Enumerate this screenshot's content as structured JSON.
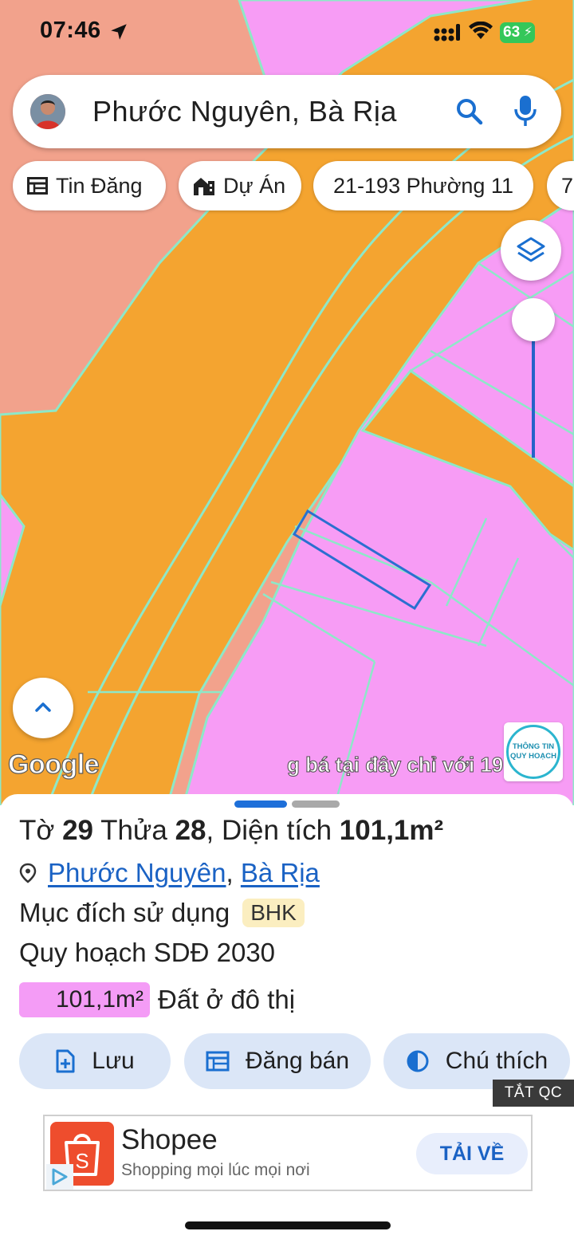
{
  "status_bar": {
    "time": "07:46",
    "battery": "63"
  },
  "search": {
    "text": "Phước Nguyên, Bà Rịa"
  },
  "chips": [
    {
      "label": "Tin Đăng",
      "icon": "listing-icon"
    },
    {
      "label": "Dự Án",
      "icon": "building-icon"
    },
    {
      "label": "21-193 Phường 11"
    },
    {
      "label": "7"
    }
  ],
  "map": {
    "attribution": "Google",
    "marquee": "g bá tại đây chỉ với 19",
    "info_badge": {
      "line1": "THÔNG TIN",
      "line2": "QUY HOẠCH"
    },
    "colors": {
      "road": "#f4a430",
      "residential": "#f79cf5",
      "other_land": "#f2a28c",
      "boundary": "#8de8c8",
      "selected": "#2a6fd0"
    },
    "opacity_slider_level": 1.0
  },
  "parcel": {
    "to_label": "Tờ ",
    "to_value": "29",
    "thua_label": " Thửa ",
    "thua_value": "28",
    "area_prefix": ", Diện tích ",
    "area_value": "101,1m²",
    "ward": "Phước Nguyên",
    "separator": ",",
    "city": "Bà Rịa",
    "purpose_label": "Mục đích sử dụng",
    "purpose_code": "BHK",
    "plan_label": "Quy hoạch SDĐ 2030",
    "plan_area": "101,1m²",
    "plan_type": "Đất ở đô thị",
    "plan_color": "#f49cf6"
  },
  "actions": {
    "save": "Lưu",
    "post": "Đăng bán",
    "legend": "Chú thích"
  },
  "ad": {
    "off_label": "TẮT QC",
    "title": "Shopee",
    "subtitle": "Shopping mọi lúc mọi nơi",
    "cta": "TẢI VỀ",
    "brand_color": "#ee4d2d"
  }
}
